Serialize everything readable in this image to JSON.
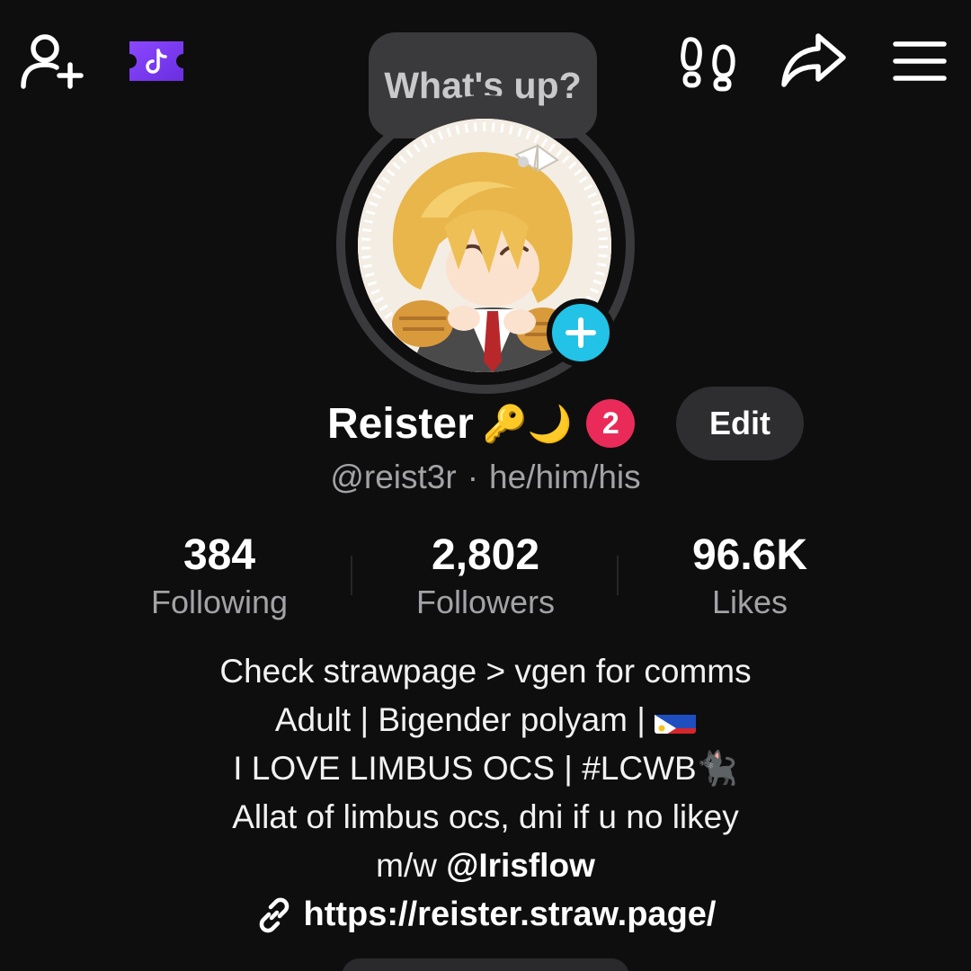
{
  "status_bubble": {
    "text": "What's up?"
  },
  "profile": {
    "display_name": "Reister",
    "name_emojis": "🔑🌙",
    "notification_count": "2",
    "edit_label": "Edit",
    "username": "@reist3r",
    "separator": "·",
    "pronouns": "he/him/his"
  },
  "stats": [
    {
      "value": "384",
      "label": "Following"
    },
    {
      "value": "2,802",
      "label": "Followers"
    },
    {
      "value": "96.6K",
      "label": "Likes"
    }
  ],
  "bio": {
    "line1": "Check strawpage > vgen for comms",
    "line2_text": "Adult | Bigender polyam | ",
    "line3_text": "I LOVE LIMBUS OCS | #LCWB",
    "line3_emoji": "🐈‍⬛",
    "line4": "Allat of limbus ocs, dni if u no likey",
    "line5_prefix": "m/w ",
    "line5_mention": "@Irisflow"
  },
  "link": {
    "url": "https://reister.straw.page/"
  },
  "icons": {
    "add_friend": "add-friend-icon",
    "tiktok_badge": "tiktok-badge-icon",
    "footprints": "footprints-icon",
    "share": "share-arrow-icon",
    "menu": "hamburger-menu-icon",
    "link": "link-icon",
    "plus": "plus-icon"
  },
  "colors": {
    "background": "#0e0e0f",
    "accent_cyan": "#22c3e6",
    "badge_red": "#ea2b5a",
    "tiktok_purple": "#7b3ff2"
  }
}
